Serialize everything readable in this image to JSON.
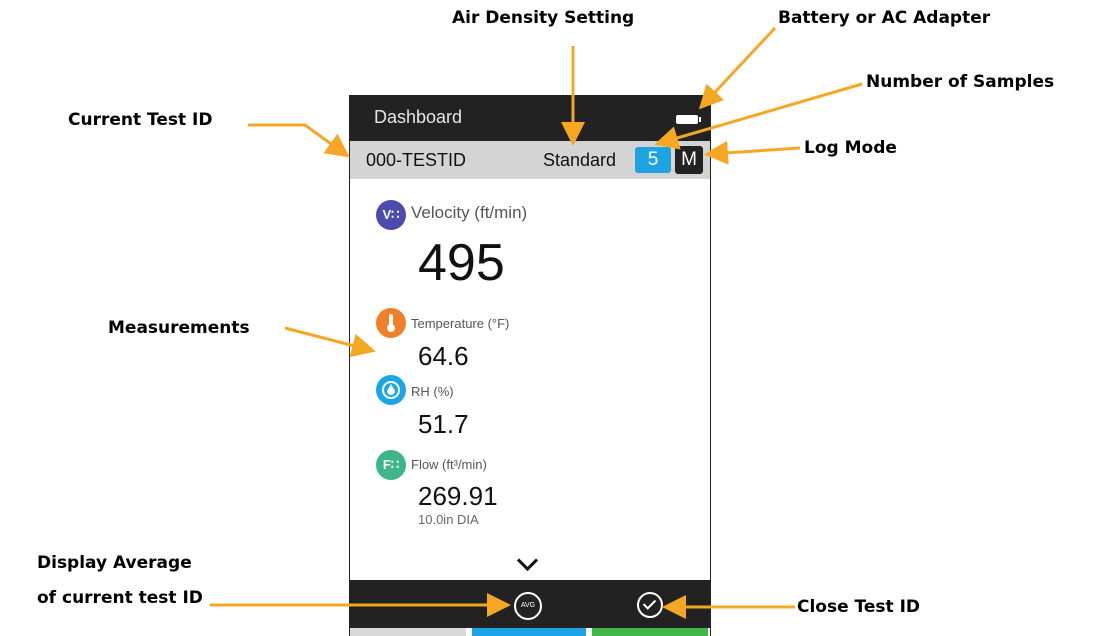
{
  "callouts": {
    "air_density_setting": "Air Density Setting",
    "battery_or_ac_adapter": "Battery or AC Adapter",
    "number_of_samples": "Number of Samples",
    "current_test_id": "Current Test ID",
    "log_mode": "Log Mode",
    "measurements": "Measurements",
    "display_average_line1": "Display Average",
    "display_average_line2": "of current test ID",
    "close_test_id": "Close Test ID"
  },
  "device": {
    "title": "Dashboard",
    "battery_icon": "battery-icon",
    "test_id": "000-TESTID",
    "air_density": "Standard",
    "samples_count": "5",
    "log_mode": "M",
    "measurements": {
      "velocity": {
        "icon_text": "V∷",
        "label": "Velocity (ft/min)",
        "value": "495",
        "color": "#4b4bb0"
      },
      "temperature": {
        "label": "Temperature (°F)",
        "value": "64.6",
        "color": "#f07f2a"
      },
      "rh": {
        "label": "RH (%)",
        "value": "51.7",
        "color": "#1aa6e6"
      },
      "flow": {
        "icon_text": "F∷",
        "label": "Flow (ft³/min)",
        "value": "269.91",
        "sub": "10.0in DIA",
        "color": "#3fb58a"
      }
    },
    "bottom": {
      "avg_label": "AVG"
    },
    "tab_colors": [
      "#d9d9d9",
      "#1da3e2",
      "#43b649"
    ]
  },
  "colors": {
    "arrow": "#f5a623"
  }
}
